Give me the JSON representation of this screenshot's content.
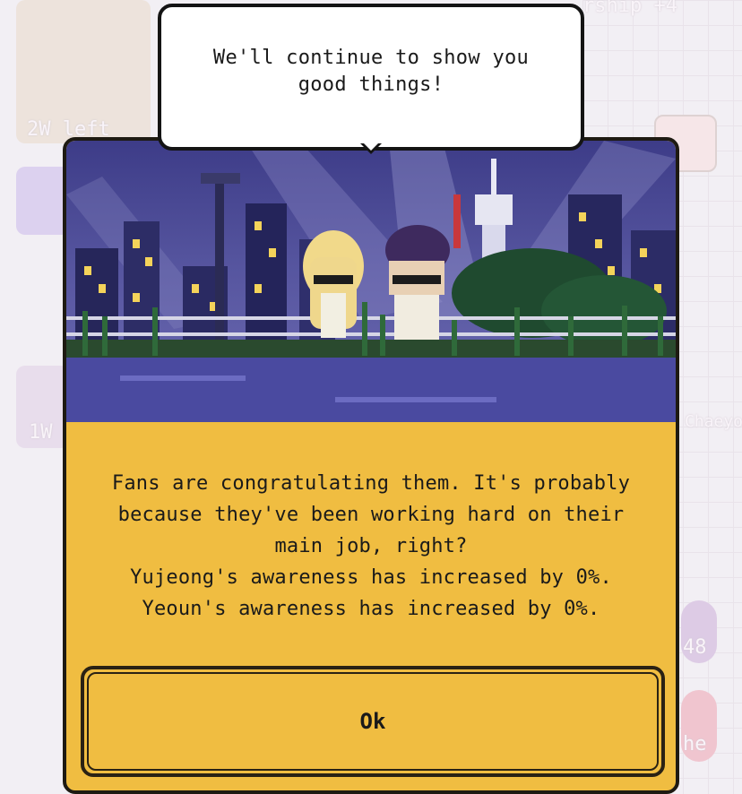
{
  "background": {
    "labels": [
      "rship +4",
      "2W left",
      "1W",
      "Chaeyo",
      "48",
      "he"
    ]
  },
  "bubble": {
    "line1": "We'll continue to show you",
    "line2": "good things!"
  },
  "dialog": {
    "scene_icon": "night-city-idol-scene",
    "message_lines": [
      "Fans are congratulating them. It's probably",
      "because they've been working hard on their",
      "main job, right?",
      "Yujeong's awareness has increased by 0%.",
      "Yeoun's awareness has increased by 0%."
    ],
    "ok_label": "Ok"
  },
  "colors": {
    "dialog_bg": "#f0bd41",
    "scene_sky": "#3d3c88"
  }
}
